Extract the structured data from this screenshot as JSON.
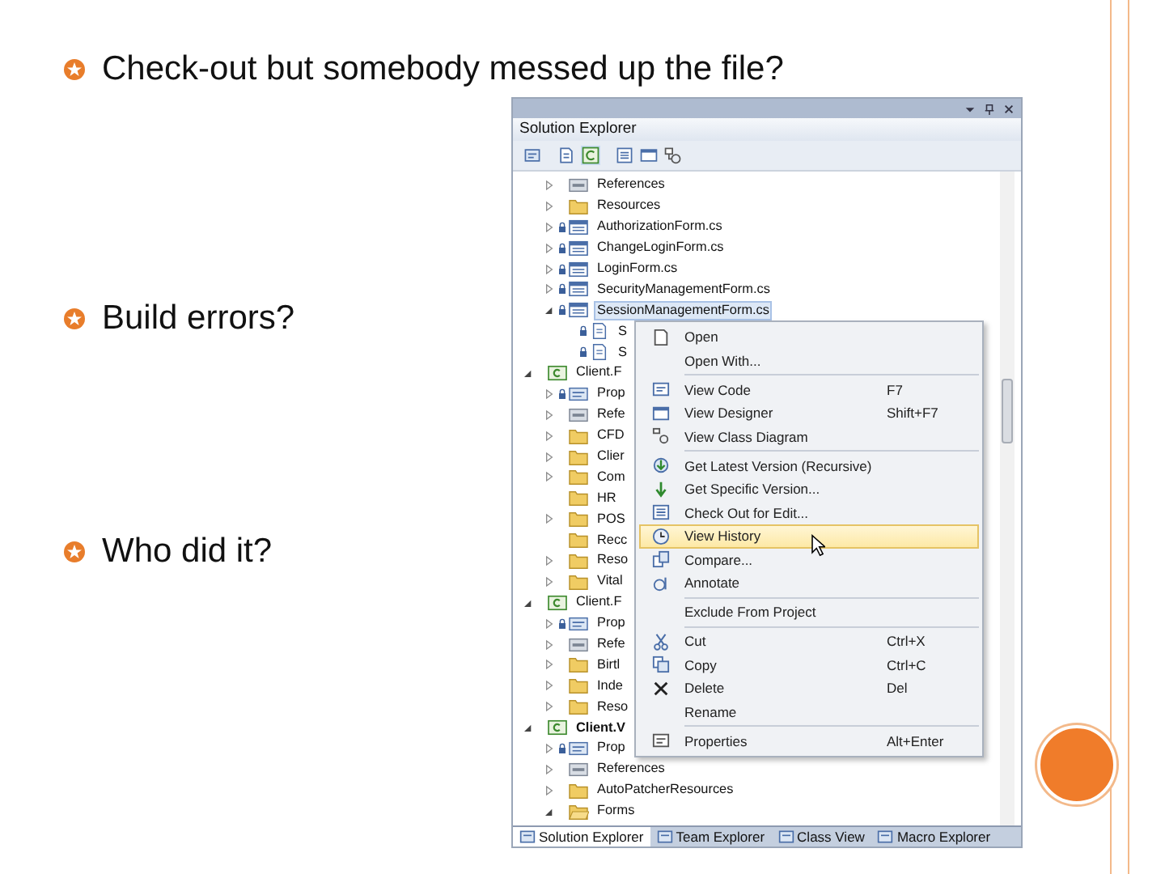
{
  "bullets": [
    "Check-out but somebody messed up the file?",
    "Build errors?",
    "Who did it?"
  ],
  "solution_explorer": {
    "title": "Solution Explorer",
    "tree_continued": [
      {
        "label": "References",
        "kind": "references",
        "expandable": true,
        "expanded": false,
        "locked": false,
        "selected": false
      },
      {
        "label": "Resources",
        "kind": "folder",
        "expandable": true,
        "expanded": false,
        "locked": false,
        "selected": false
      },
      {
        "label": "AuthorizationForm.cs",
        "kind": "form",
        "expandable": true,
        "expanded": false,
        "locked": true,
        "selected": false
      },
      {
        "label": "ChangeLoginForm.cs",
        "kind": "form",
        "expandable": true,
        "expanded": false,
        "locked": true,
        "selected": false
      },
      {
        "label": "LoginForm.cs",
        "kind": "form",
        "expandable": true,
        "expanded": false,
        "locked": true,
        "selected": false
      },
      {
        "label": "SecurityManagementForm.cs",
        "kind": "form",
        "expandable": true,
        "expanded": false,
        "locked": true,
        "selected": false
      },
      {
        "label": "SessionManagementForm.cs",
        "kind": "form",
        "expandable": true,
        "expanded": true,
        "locked": true,
        "selected": true,
        "children": [
          {
            "label": "S",
            "kind": "file",
            "expandable": false,
            "locked": true,
            "selected": false
          },
          {
            "label": "S",
            "kind": "file",
            "expandable": false,
            "locked": true,
            "selected": false
          }
        ]
      }
    ],
    "projects": [
      {
        "label": "Client.F",
        "kind": "project",
        "expandable": true,
        "expanded": true,
        "locked": false,
        "selected": false,
        "bold": false,
        "children": [
          {
            "label": "Prop",
            "kind": "properties",
            "expandable": true,
            "expanded": false,
            "locked": true,
            "selected": false
          },
          {
            "label": "Refe",
            "kind": "references",
            "expandable": true,
            "expanded": false,
            "locked": false,
            "selected": false
          },
          {
            "label": "CFD",
            "kind": "folder",
            "expandable": true,
            "expanded": false,
            "locked": false,
            "selected": false
          },
          {
            "label": "Clier",
            "kind": "folder",
            "expandable": true,
            "expanded": false,
            "locked": false,
            "selected": false
          },
          {
            "label": "Com",
            "kind": "folder",
            "expandable": true,
            "expanded": false,
            "locked": false,
            "selected": false
          },
          {
            "label": "HR",
            "kind": "folder",
            "expandable": false,
            "locked": false,
            "selected": false
          },
          {
            "label": "POS",
            "kind": "folder",
            "expandable": true,
            "expanded": false,
            "locked": false,
            "selected": false
          },
          {
            "label": "Recc",
            "kind": "folder",
            "expandable": false,
            "locked": false,
            "selected": false
          },
          {
            "label": "Reso",
            "kind": "folder",
            "expandable": true,
            "expanded": false,
            "locked": false,
            "selected": false
          },
          {
            "label": "Vital",
            "kind": "folder",
            "expandable": true,
            "expanded": false,
            "locked": false,
            "selected": false
          }
        ]
      },
      {
        "label": "Client.F",
        "kind": "project",
        "expandable": true,
        "expanded": true,
        "locked": false,
        "selected": false,
        "bold": false,
        "children": [
          {
            "label": "Prop",
            "kind": "properties",
            "expandable": true,
            "expanded": false,
            "locked": true,
            "selected": false
          },
          {
            "label": "Refe",
            "kind": "references",
            "expandable": true,
            "expanded": false,
            "locked": false,
            "selected": false
          },
          {
            "label": "Birtl",
            "kind": "folder",
            "expandable": true,
            "expanded": false,
            "locked": false,
            "selected": false
          },
          {
            "label": "Inde",
            "kind": "folder",
            "expandable": true,
            "expanded": false,
            "locked": false,
            "selected": false
          },
          {
            "label": "Reso",
            "kind": "folder",
            "expandable": true,
            "expanded": false,
            "locked": false,
            "selected": false
          }
        ]
      },
      {
        "label": "Client.V",
        "kind": "project",
        "expandable": true,
        "expanded": true,
        "locked": false,
        "selected": false,
        "bold": true,
        "children": [
          {
            "label": "Prop",
            "kind": "properties",
            "expandable": true,
            "expanded": false,
            "locked": true,
            "selected": false
          },
          {
            "label": "References",
            "kind": "references",
            "expandable": true,
            "expanded": false,
            "locked": false,
            "selected": false
          },
          {
            "label": "AutoPatcherResources",
            "kind": "folder",
            "expandable": true,
            "expanded": false,
            "locked": false,
            "selected": false
          },
          {
            "label": "Forms",
            "kind": "folder-open",
            "expandable": true,
            "expanded": true,
            "locked": false,
            "selected": false
          }
        ]
      }
    ],
    "context_menu": [
      {
        "kind": "item",
        "label": "Open",
        "selected": false
      },
      {
        "kind": "item",
        "label": "Open With...",
        "selected": false
      },
      {
        "kind": "separator"
      },
      {
        "kind": "item",
        "label": "View Code",
        "shortcut": "F7",
        "selected": false
      },
      {
        "kind": "item",
        "label": "View Designer",
        "shortcut": "Shift+F7",
        "selected": false
      },
      {
        "kind": "item",
        "label": "View Class Diagram",
        "selected": false
      },
      {
        "kind": "separator"
      },
      {
        "kind": "item",
        "label": "Get Latest Version (Recursive)",
        "selected": false
      },
      {
        "kind": "item",
        "label": "Get Specific Version...",
        "selected": false
      },
      {
        "kind": "item",
        "label": "Check Out for Edit...",
        "selected": false
      },
      {
        "kind": "item",
        "label": "View History",
        "selected": true
      },
      {
        "kind": "item",
        "label": "Compare...",
        "selected": false
      },
      {
        "kind": "item",
        "label": "Annotate",
        "selected": false
      },
      {
        "kind": "separator"
      },
      {
        "kind": "item",
        "label": "Exclude From Project",
        "selected": false
      },
      {
        "kind": "separator"
      },
      {
        "kind": "item",
        "label": "Cut",
        "shortcut": "Ctrl+X",
        "selected": false
      },
      {
        "kind": "item",
        "label": "Copy",
        "shortcut": "Ctrl+C",
        "selected": false
      },
      {
        "kind": "item",
        "label": "Delete",
        "shortcut": "Del",
        "selected": false
      },
      {
        "kind": "item",
        "label": "Rename",
        "selected": false
      },
      {
        "kind": "separator"
      },
      {
        "kind": "item",
        "label": "Properties",
        "shortcut": "Alt+Enter",
        "selected": false
      }
    ],
    "bottom_tabs": [
      {
        "label": "Solution Explorer",
        "selected": true
      },
      {
        "label": "Team Explorer",
        "selected": false
      },
      {
        "label": "Class View",
        "selected": false
      },
      {
        "label": "Macro Explorer",
        "selected": false
      }
    ]
  }
}
